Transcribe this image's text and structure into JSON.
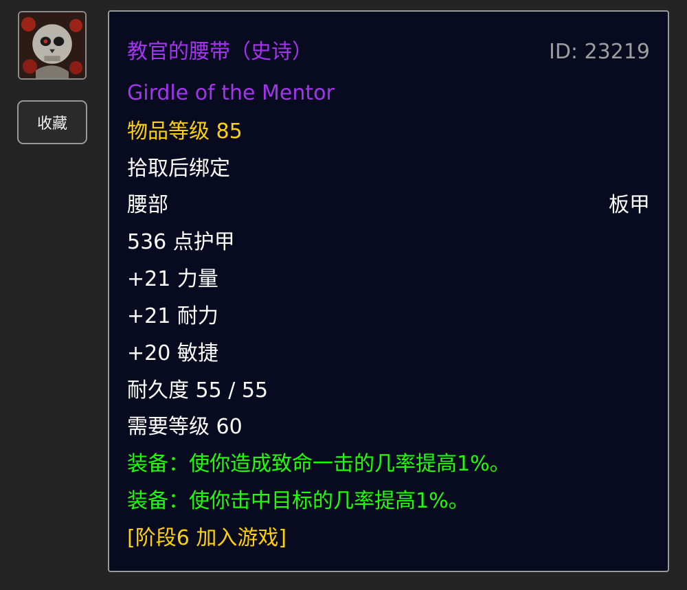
{
  "item": {
    "name_zh": "教官的腰带（史诗）",
    "name_en": "Girdle of the Mentor",
    "id_text": "ID: 23219",
    "item_level": "物品等级 85",
    "binding": "拾取后绑定",
    "slot": "腰部",
    "armor_type": "板甲",
    "armor": "536 点护甲",
    "stats": [
      "+21 力量",
      "+21 耐力",
      "+20 敏捷"
    ],
    "durability": "耐久度 55 / 55",
    "required_level": "需要等级 60",
    "equip_effects": [
      "装备：使你造成致命一击的几率提高1%。",
      "装备：使你击中目标的几率提高1%。"
    ],
    "phase": "[阶段6 加入游戏]"
  },
  "sidebar": {
    "favorite_label": "收藏",
    "icon": "skull-armor-icon"
  },
  "colors": {
    "epic": "#a335ee",
    "item_level": "#ffd100",
    "equip_effect": "#1eff00",
    "id": "#9d9d9d",
    "background": "#080b1f"
  }
}
